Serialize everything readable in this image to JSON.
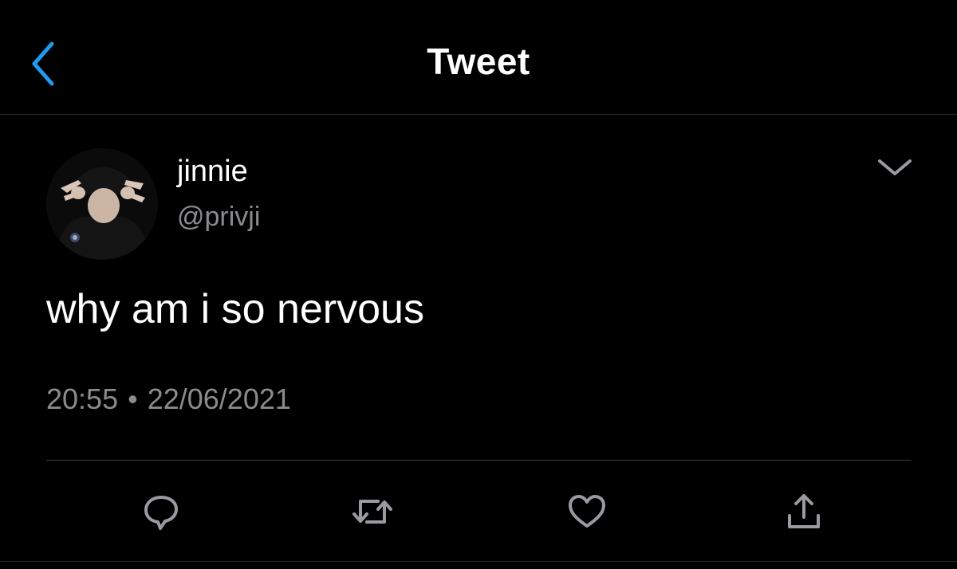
{
  "header": {
    "title": "Tweet",
    "back_icon": "chevron-left-icon"
  },
  "author": {
    "display_name": "jinnie",
    "handle": "@privji",
    "avatar_icon": "avatar"
  },
  "tweet": {
    "text": "why am i so nervous",
    "time": "20:55",
    "separator": "•",
    "date": "22/06/2021"
  },
  "actions": [
    {
      "name": "reply",
      "icon": "reply-icon"
    },
    {
      "name": "retweet",
      "icon": "retweet-icon"
    },
    {
      "name": "like",
      "icon": "heart-icon"
    },
    {
      "name": "share",
      "icon": "share-icon"
    }
  ],
  "colors": {
    "background": "#000000",
    "accent": "#1d9bf0",
    "secondary_text": "#8b8b8f",
    "icon": "#9a9aa0"
  }
}
